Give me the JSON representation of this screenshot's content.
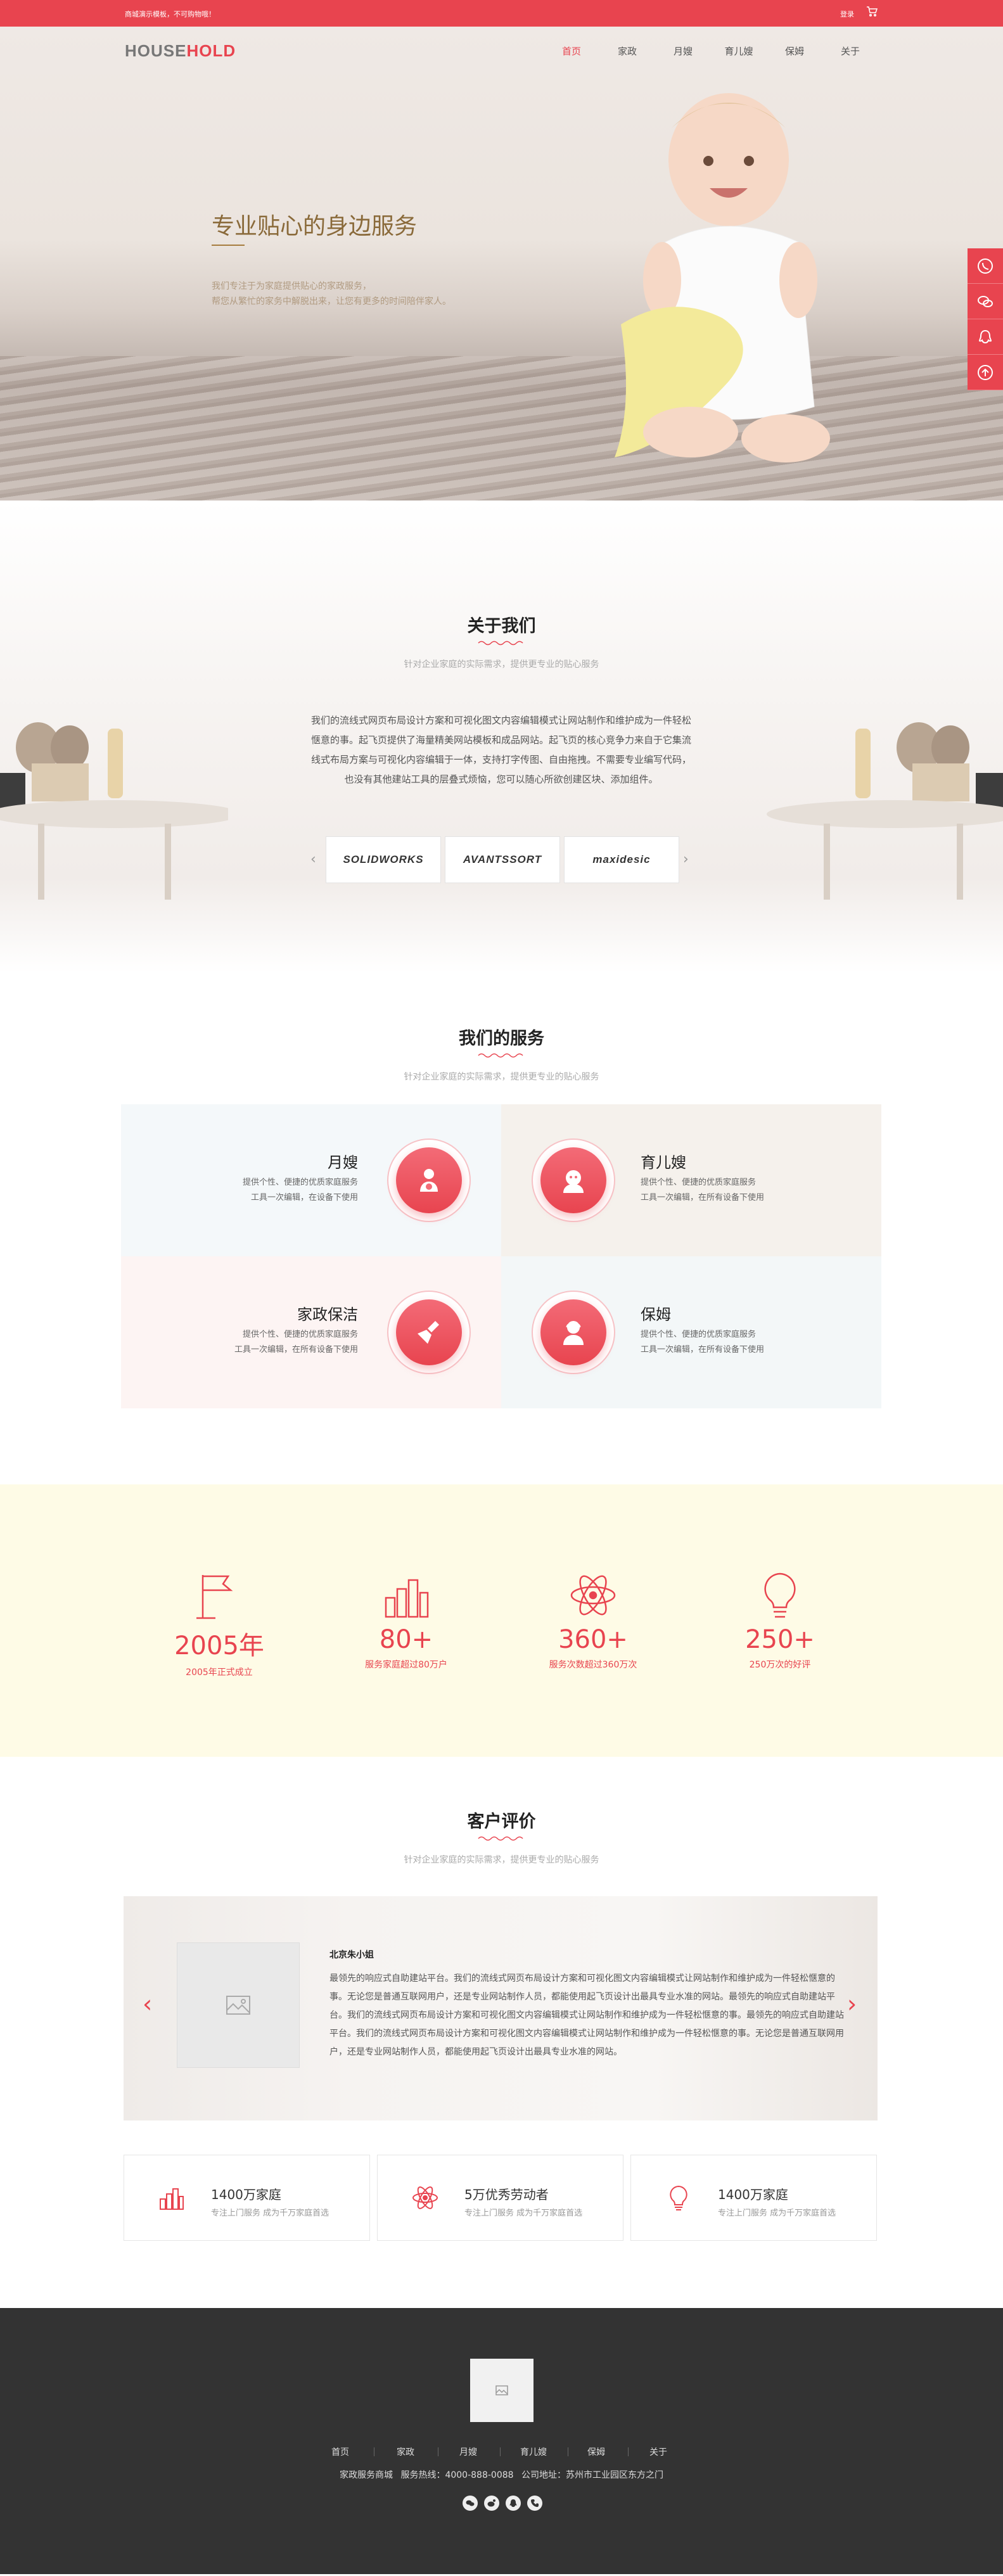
{
  "topbar": {
    "notice": "商城演示模板，不可购物哦！",
    "login": "登录"
  },
  "header": {
    "logo_a": "HOUSE",
    "logo_b": "HOLD",
    "nav": [
      "首页",
      "家政",
      "月嫂",
      "育儿嫂",
      "保姆",
      "关于"
    ]
  },
  "hero": {
    "title": "专业贴心的身边服务",
    "sub1": "我们专注于为家庭提供贴心的家政服务，",
    "sub2": "帮您从繁忙的家务中解脱出来，让您有更多的时间陪伴家人。"
  },
  "about": {
    "title": "关于我们",
    "subtitle": "针对企业家庭的实际需求，提供更专业的贴心服务",
    "text": "我们的流线式网页布局设计方案和可视化图文内容编辑模式让网站制作和维护成为一件轻松惬意的事。起飞页提供了海量精美网站模板和成品网站。起飞页的核心竞争力来自于它集流线式布局方案与可视化内容编辑于一体，支持打字传图、自由拖拽。不需要专业编写代码，也没有其他建站工具的层叠式烦恼，您可以随心所欲创建区块、添加组件。",
    "brands": [
      "SOLIDWORKS",
      "AVANTSSORT",
      "maxidesic"
    ]
  },
  "services": {
    "title": "我们的服务",
    "subtitle": "针对企业家庭的实际需求，提供更专业的贴心服务",
    "items": [
      {
        "name": "月嫂",
        "desc1": "提供个性、便捷的优质家庭服务",
        "desc2": "工具一次编辑，在设备下使用"
      },
      {
        "name": "育儿嫂",
        "desc1": "提供个性、便捷的优质家庭服务",
        "desc2": "工具一次编辑，在所有设备下使用"
      },
      {
        "name": "家政保洁",
        "desc1": "提供个性、便捷的优质家庭服务",
        "desc2": "工具一次编辑，在所有设备下使用"
      },
      {
        "name": "保姆",
        "desc1": "提供个性、便捷的优质家庭服务",
        "desc2": "工具一次编辑，在所有设备下使用"
      }
    ]
  },
  "stats": [
    {
      "num": "2005年",
      "label": "2005年正式成立",
      "icon": "flag-icon"
    },
    {
      "num": "80+",
      "label": "服务家庭超过80万户",
      "icon": "bar-chart-icon"
    },
    {
      "num": "360+",
      "label": "服务次数超过360万次",
      "icon": "atom-icon"
    },
    {
      "num": "250+",
      "label": "250万次的好评",
      "icon": "lightbulb-icon"
    }
  ],
  "reviews": {
    "title": "客户评价",
    "subtitle": "针对企业家庭的实际需求，提供更专业的贴心服务",
    "name": "北京朱小姐",
    "text": "最领先的响应式自助建站平台。我们的流线式网页布局设计方案和可视化图文内容编辑模式让网站制作和维护成为一件轻松惬意的事。无论您是普通互联网用户，还是专业网站制作人员，都能使用起飞页设计出最具专业水准的网站。最领先的响应式自助建站平台。我们的流线式网页布局设计方案和可视化图文内容编辑模式让网站制作和维护成为一件轻松惬意的事。最领先的响应式自助建站平台。我们的流线式网页布局设计方案和可视化图文内容编辑模式让网站制作和维护成为一件轻松惬意的事。无论您是普通互联网用户，还是专业网站制作人员，都能使用起飞页设计出最具专业水准的网站。"
  },
  "features": [
    {
      "title": "1400万家庭",
      "desc": "专注上门服务 成为千万家庭首选",
      "icon": "bar-chart-icon"
    },
    {
      "title": "5万优秀劳动者",
      "desc": "专注上门服务 成为千万家庭首选",
      "icon": "atom-icon"
    },
    {
      "title": "1400万家庭",
      "desc": "专注上门服务 成为千万家庭首选",
      "icon": "lightbulb-icon"
    }
  ],
  "footer": {
    "nav": [
      "首页",
      "家政",
      "月嫂",
      "育儿嫂",
      "保姆",
      "关于"
    ],
    "company": "家政服务商城",
    "phone": "服务热线：4000-888-0088",
    "address": "公司地址：苏州市工业园区东方之门"
  },
  "colors": {
    "accent": "#e8444f",
    "footer": "#333333",
    "stats_bg": "#fefbe6"
  }
}
